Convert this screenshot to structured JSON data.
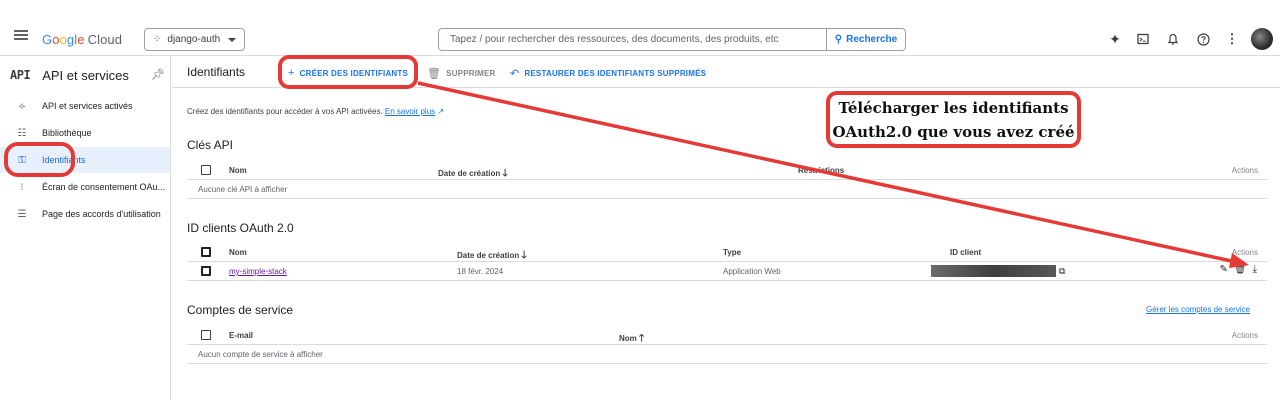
{
  "topbar": {
    "logo_parts": [
      "G",
      "o",
      "o",
      "g",
      "l",
      "e"
    ],
    "logo_suffix": "Cloud",
    "project_name": "django-auth",
    "search_placeholder": "Tapez / pour rechercher des ressources, des documents, des produits, etc",
    "search_button": "Recherche",
    "icons": [
      "gemini-icon",
      "terminal-icon",
      "bell-icon",
      "help-icon",
      "more-vert-icon",
      "avatar"
    ]
  },
  "sidebar": {
    "api_badge": "API",
    "title": "API et services",
    "items": [
      {
        "label": "API et services activés",
        "icon": "hub-icon",
        "active": false
      },
      {
        "label": "Bibliothèque",
        "icon": "library-icon",
        "active": false
      },
      {
        "label": "Identifiants",
        "icon": "key-icon",
        "active": true
      },
      {
        "label": "Écran de consentement OAu...",
        "icon": "consent-icon",
        "active": false
      },
      {
        "label": "Page des accords d'utilisation",
        "icon": "settings-list-icon",
        "active": false
      }
    ]
  },
  "header": {
    "title": "Identifiants",
    "create": "CRÉER DES IDENTIFIANTS",
    "delete": "SUPPRIMER",
    "restore": "RESTAURER DES IDENTIFIANTS SUPPRIMÉS"
  },
  "intro": {
    "text": "Créez des identifiants pour accéder à vos API activées.",
    "link": "En savoir plus"
  },
  "api_keys": {
    "title": "Clés API",
    "columns": [
      "Nom",
      "Date de création",
      "Restrictions",
      "Actions"
    ],
    "empty": "Aucune clé API à afficher"
  },
  "oauth": {
    "title": "ID clients OAuth 2.0",
    "columns": [
      "Nom",
      "Date de création",
      "Type",
      "ID client",
      "Actions"
    ],
    "rows": [
      {
        "name": "my-simple-stack",
        "date": "18 févr. 2024",
        "type": "Application Web"
      }
    ]
  },
  "service_accounts": {
    "title": "Comptes de service",
    "manage_link": "Gérer les comptes de service",
    "columns": [
      "E-mail",
      "Nom",
      "Actions"
    ],
    "empty": "Aucun compte de service à afficher"
  },
  "annotation": {
    "line1": "Télécharger les identifiants",
    "line2": "OAuth2.0 que vous avez créé",
    "color": "#e53935"
  }
}
